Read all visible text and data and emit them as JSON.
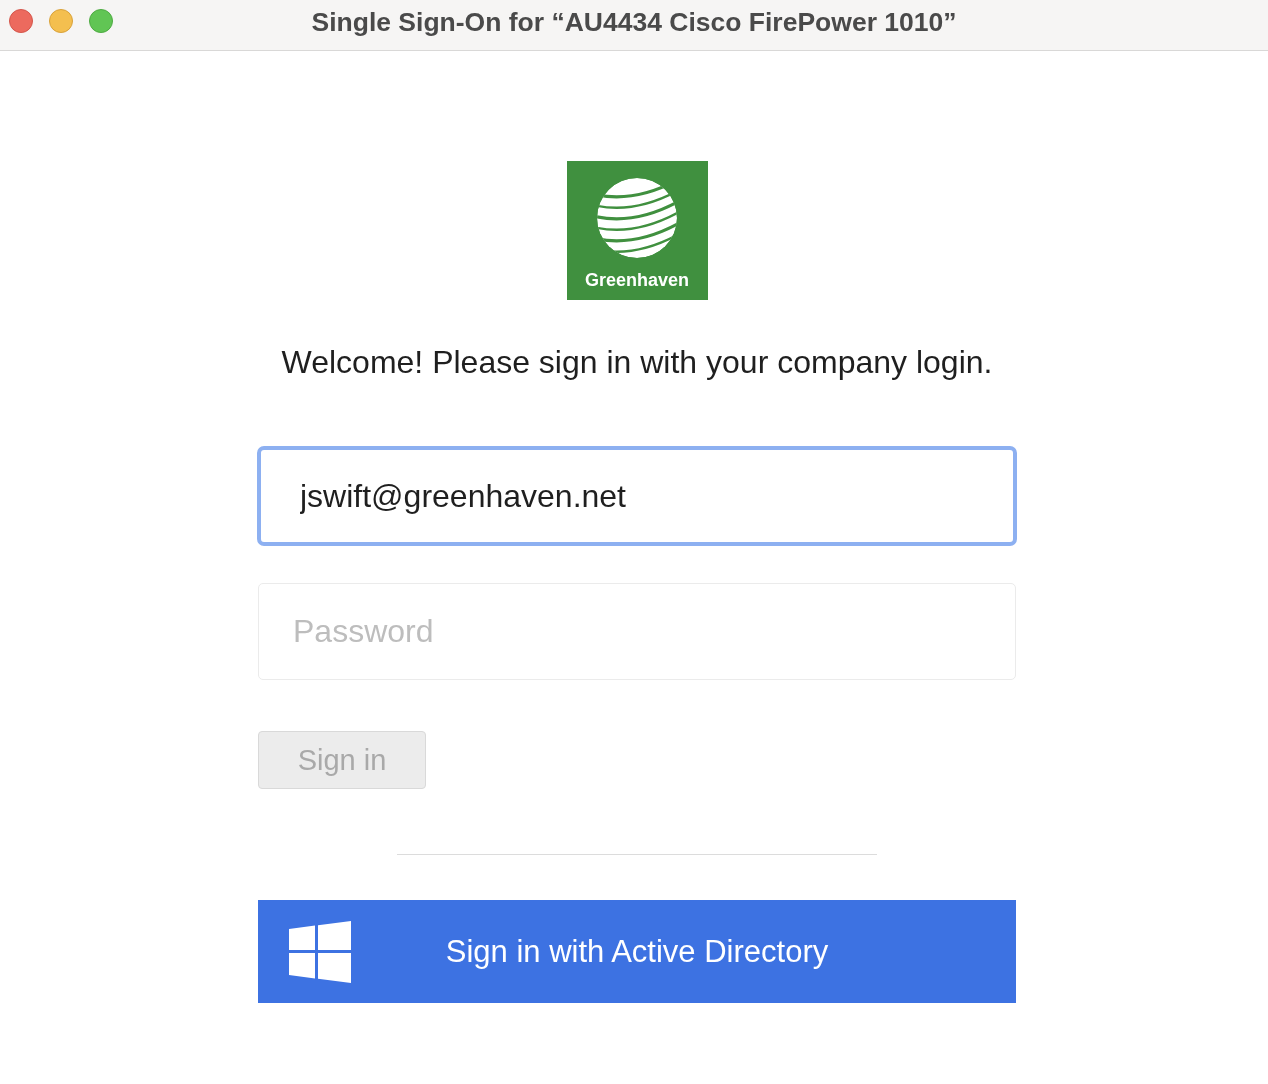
{
  "window": {
    "title": "Single Sign-On for “AU4434 Cisco FirePower 1010”"
  },
  "logo": {
    "text": "Greenhaven"
  },
  "welcome": "Welcome! Please sign in with your company login.",
  "email_field": {
    "value": "jswift@greenhaven.net",
    "focused": true
  },
  "password_field": {
    "placeholder": "Password"
  },
  "sign_in_button": {
    "label": "Sign in",
    "disabled": true
  },
  "sso_button": {
    "label": "Sign in with Active Directory"
  }
}
